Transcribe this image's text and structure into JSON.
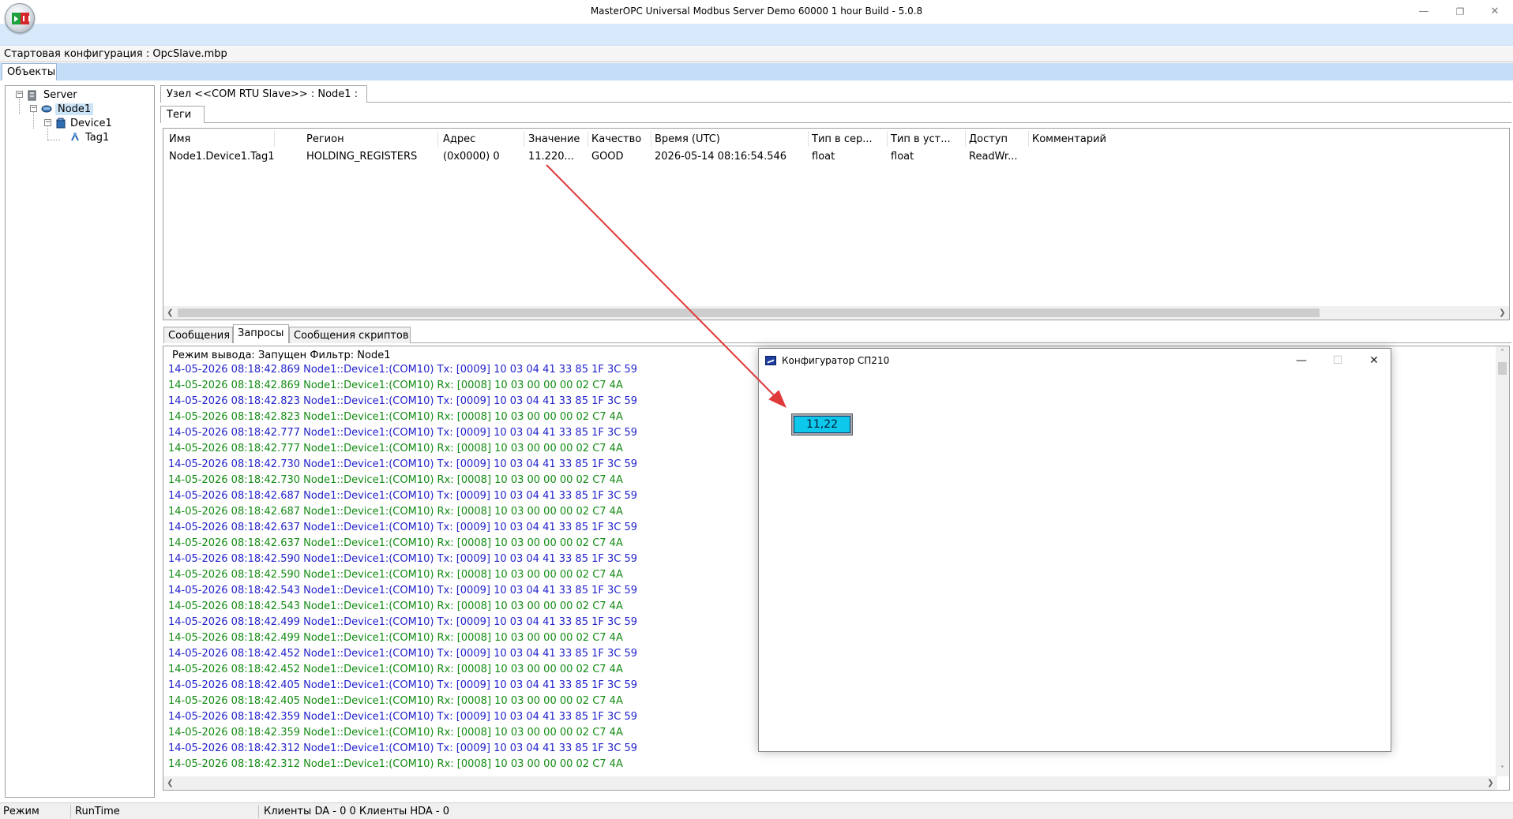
{
  "window": {
    "title": "MasterOPC Universal Modbus Server Demo 60000 1 hour Build - 5.0.8",
    "controls": {
      "minimize": "—",
      "restore": "❐",
      "close": "✕"
    }
  },
  "config_bar": {
    "text": "Стартовая конфигурация : OpcSlave.mbp"
  },
  "objects_tab": {
    "label": "Объекты"
  },
  "tree": {
    "server": "Server",
    "node": "Node1",
    "device": "Device1",
    "tag": "Tag1"
  },
  "node_panel": {
    "title": "Узел <<COM RTU Slave>> : Node1 :",
    "tab_tags": "Теги"
  },
  "tags_table": {
    "columns": [
      "Имя",
      "Регион",
      "Адрес",
      "Значение",
      "Качество",
      "Время (UTC)",
      "Тип в сер...",
      "Тип в уст...",
      "Доступ",
      "Комментарий"
    ],
    "rows": [
      {
        "name": "Node1.Device1.Tag1",
        "region": "HOLDING_REGISTERS",
        "address": "(0x0000) 0",
        "value": "11.220...",
        "quality": "GOOD",
        "time": "2026-05-14 08:16:54.546",
        "server_type": "float",
        "device_type": "float",
        "access": "ReadWr...",
        "comment": ""
      }
    ]
  },
  "lower_tabs": [
    "Сообщения",
    "Запросы",
    "Сообщения скриптов"
  ],
  "log": {
    "header": "Режим вывода: Запущен Фильтр: Node1",
    "lines": [
      {
        "kind": "tx",
        "text": "14-05-2026 08:18:42.869 Node1::Device1:(COM10) Tx: [0009] 10 03 04 41 33 85 1F 3C 59"
      },
      {
        "kind": "rx",
        "text": "14-05-2026 08:18:42.869 Node1::Device1:(COM10) Rx: [0008] 10 03 00 00 00 02 C7 4A"
      },
      {
        "kind": "tx",
        "text": "14-05-2026 08:18:42.823 Node1::Device1:(COM10) Tx: [0009] 10 03 04 41 33 85 1F 3C 59"
      },
      {
        "kind": "rx",
        "text": "14-05-2026 08:18:42.823 Node1::Device1:(COM10) Rx: [0008] 10 03 00 00 00 02 C7 4A"
      },
      {
        "kind": "tx",
        "text": "14-05-2026 08:18:42.777 Node1::Device1:(COM10) Tx: [0009] 10 03 04 41 33 85 1F 3C 59"
      },
      {
        "kind": "rx",
        "text": "14-05-2026 08:18:42.777 Node1::Device1:(COM10) Rx: [0008] 10 03 00 00 00 02 C7 4A"
      },
      {
        "kind": "tx",
        "text": "14-05-2026 08:18:42.730 Node1::Device1:(COM10) Tx: [0009] 10 03 04 41 33 85 1F 3C 59"
      },
      {
        "kind": "rx",
        "text": "14-05-2026 08:18:42.730 Node1::Device1:(COM10) Rx: [0008] 10 03 00 00 00 02 C7 4A"
      },
      {
        "kind": "tx",
        "text": "14-05-2026 08:18:42.687 Node1::Device1:(COM10) Tx: [0009] 10 03 04 41 33 85 1F 3C 59"
      },
      {
        "kind": "rx",
        "text": "14-05-2026 08:18:42.687 Node1::Device1:(COM10) Rx: [0008] 10 03 00 00 00 02 C7 4A"
      },
      {
        "kind": "tx",
        "text": "14-05-2026 08:18:42.637 Node1::Device1:(COM10) Tx: [0009] 10 03 04 41 33 85 1F 3C 59"
      },
      {
        "kind": "rx",
        "text": "14-05-2026 08:18:42.637 Node1::Device1:(COM10) Rx: [0008] 10 03 00 00 00 02 C7 4A"
      },
      {
        "kind": "tx",
        "text": "14-05-2026 08:18:42.590 Node1::Device1:(COM10) Tx: [0009] 10 03 04 41 33 85 1F 3C 59"
      },
      {
        "kind": "rx",
        "text": "14-05-2026 08:18:42.590 Node1::Device1:(COM10) Rx: [0008] 10 03 00 00 00 02 C7 4A"
      },
      {
        "kind": "tx",
        "text": "14-05-2026 08:18:42.543 Node1::Device1:(COM10) Tx: [0009] 10 03 04 41 33 85 1F 3C 59"
      },
      {
        "kind": "rx",
        "text": "14-05-2026 08:18:42.543 Node1::Device1:(COM10) Rx: [0008] 10 03 00 00 00 02 C7 4A"
      },
      {
        "kind": "tx",
        "text": "14-05-2026 08:18:42.499 Node1::Device1:(COM10) Tx: [0009] 10 03 04 41 33 85 1F 3C 59"
      },
      {
        "kind": "rx",
        "text": "14-05-2026 08:18:42.499 Node1::Device1:(COM10) Rx: [0008] 10 03 00 00 00 02 C7 4A"
      },
      {
        "kind": "tx",
        "text": "14-05-2026 08:18:42.452 Node1::Device1:(COM10) Tx: [0009] 10 03 04 41 33 85 1F 3C 59"
      },
      {
        "kind": "rx",
        "text": "14-05-2026 08:18:42.452 Node1::Device1:(COM10) Rx: [0008] 10 03 00 00 00 02 C7 4A"
      },
      {
        "kind": "tx",
        "text": "14-05-2026 08:18:42.405 Node1::Device1:(COM10) Tx: [0009] 10 03 04 41 33 85 1F 3C 59"
      },
      {
        "kind": "rx",
        "text": "14-05-2026 08:18:42.405 Node1::Device1:(COM10) Rx: [0008] 10 03 00 00 00 02 C7 4A"
      },
      {
        "kind": "tx",
        "text": "14-05-2026 08:18:42.359 Node1::Device1:(COM10) Tx: [0009] 10 03 04 41 33 85 1F 3C 59"
      },
      {
        "kind": "rx",
        "text": "14-05-2026 08:18:42.359 Node1::Device1:(COM10) Rx: [0008] 10 03 00 00 00 02 C7 4A"
      },
      {
        "kind": "tx",
        "text": "14-05-2026 08:18:42.312 Node1::Device1:(COM10) Tx: [0009] 10 03 04 41 33 85 1F 3C 59"
      },
      {
        "kind": "rx",
        "text": "14-05-2026 08:18:42.312 Node1::Device1:(COM10) Rx: [0008] 10 03 00 00 00 02 C7 4A"
      }
    ]
  },
  "statusbar": {
    "mode_label": "Режим",
    "mode_value": "RunTime",
    "clients": "Клиенты DA - 0 0 Клиенты HDA - 0"
  },
  "sp_window": {
    "title": "Конфигуратор СП210",
    "value": "11,22",
    "controls": {
      "minimize": "—",
      "maximize": "☐",
      "close": "✕"
    }
  },
  "colors": {
    "tx": "#2222cc",
    "rx": "#138c13",
    "arrow": "#e0393a",
    "value_box": "#0ec8ec"
  }
}
